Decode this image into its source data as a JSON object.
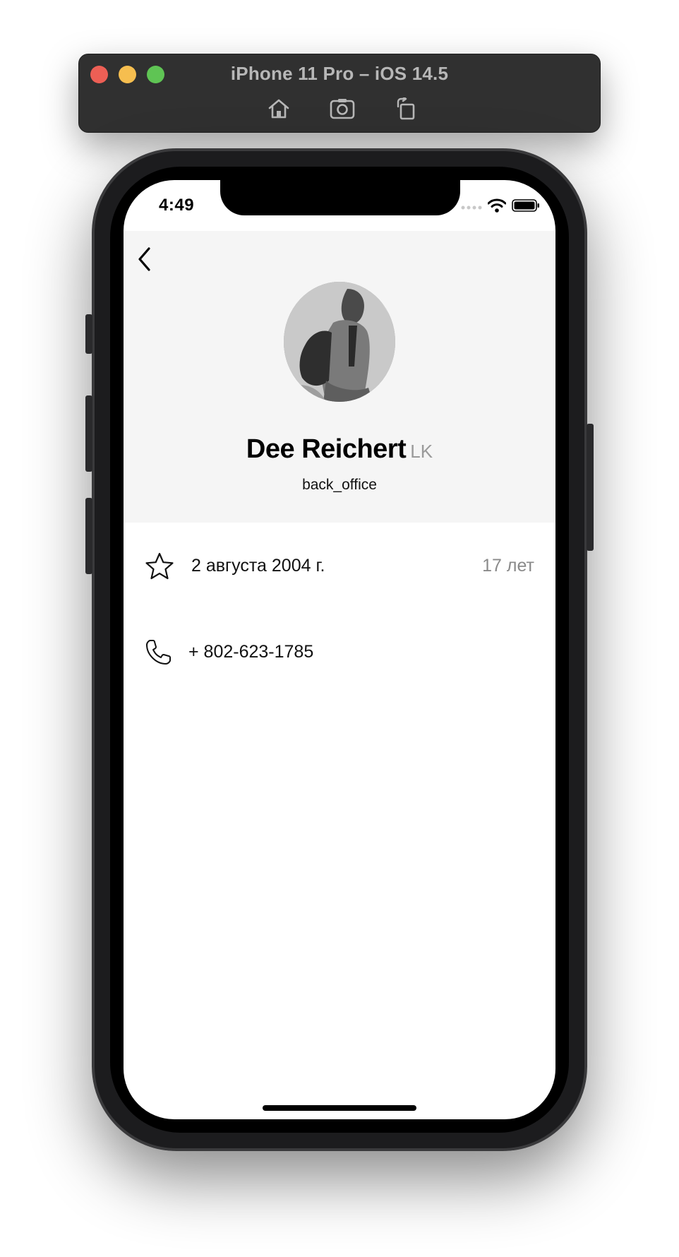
{
  "simulator": {
    "title": "iPhone 11 Pro – iOS 14.5",
    "tools": [
      {
        "name": "home-icon"
      },
      {
        "name": "screenshot-icon"
      },
      {
        "name": "rotate-icon"
      }
    ]
  },
  "status_bar": {
    "time": "4:49",
    "icons": [
      "cellular-icon",
      "wifi-icon",
      "battery-icon"
    ]
  },
  "profile": {
    "back_icon": "chevron-left-icon",
    "name": "Dee Reichert",
    "name_suffix": "LK",
    "role": "back_office"
  },
  "details": {
    "birthday": {
      "icon": "star-icon",
      "date": "2 августа 2004 г.",
      "age": "17 лет"
    },
    "phone": {
      "icon": "phone-icon",
      "number": "+ 802-623-1785"
    }
  },
  "colors": {
    "header_bg": "#f5f5f5",
    "screen_bg": "#ffffff",
    "secondary_text": "#8a8a8a"
  }
}
